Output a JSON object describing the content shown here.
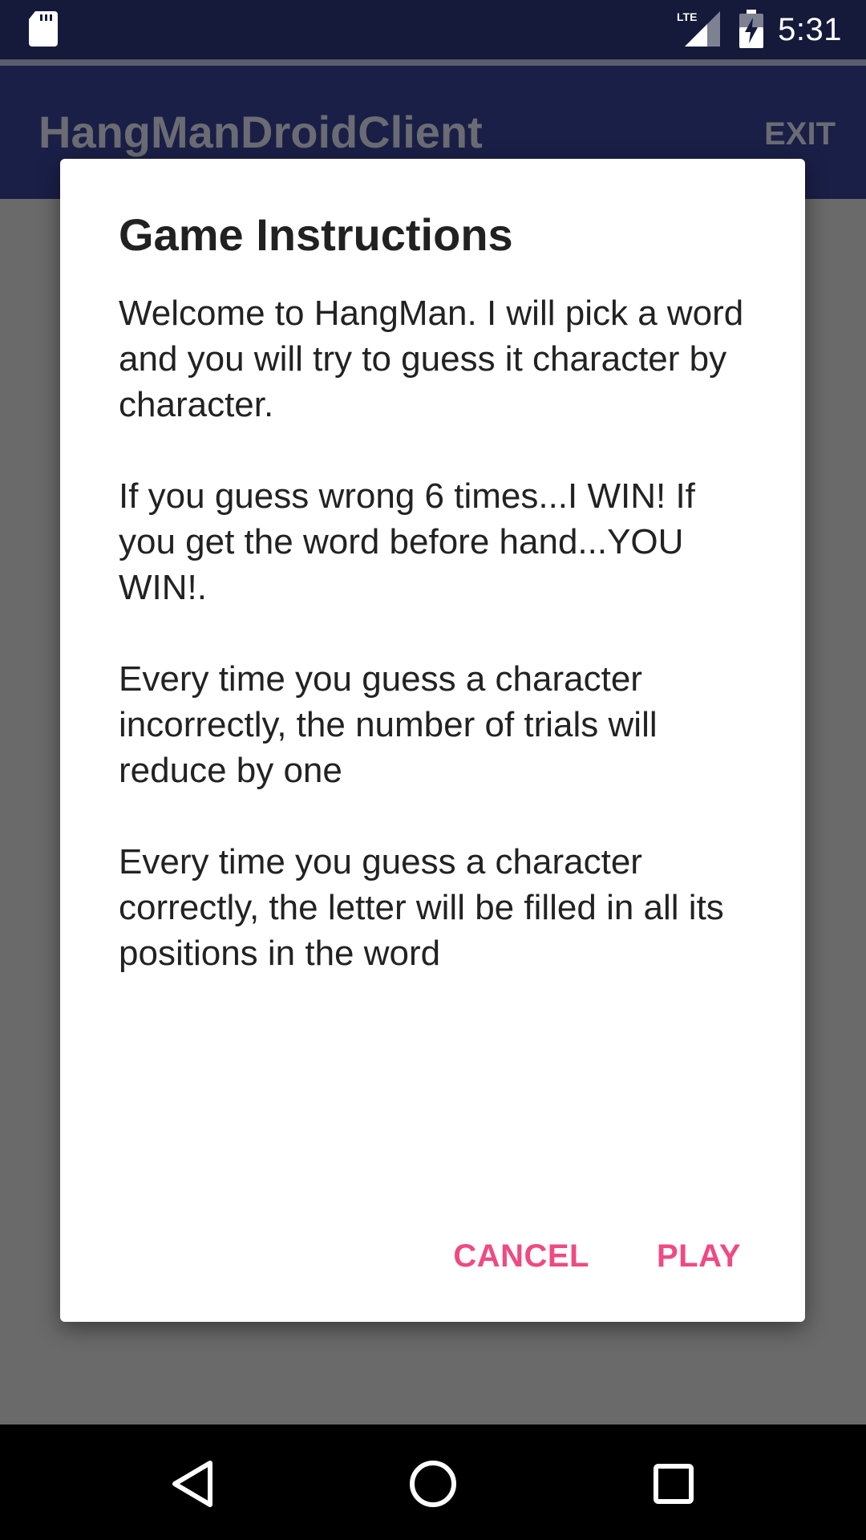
{
  "status_bar": {
    "time": "5:31",
    "network_label": "LTE",
    "icons": [
      "sd-card-icon",
      "signal-icon",
      "battery-icon"
    ]
  },
  "app_bar": {
    "title": "HangManDroidClient",
    "action_exit": "EXIT"
  },
  "dialog": {
    "title": "Game Instructions",
    "paragraphs": [
      "Welcome to HangMan. I will pick a word and you will try to guess it character by character.",
      "If you guess wrong 6 times...I WIN! If you get the word before hand...YOU WIN!.",
      "Every time you guess a character incorrectly, the number of trials will reduce by one",
      "Every time you guess a character correctly, the letter will be filled in all its positions in the word"
    ],
    "buttons": {
      "cancel": "CANCEL",
      "play": "PLAY"
    }
  },
  "nav_bar": {
    "icons": [
      "back-icon",
      "home-icon",
      "recents-icon"
    ]
  },
  "colors": {
    "status_bar": "#151a3a",
    "app_bar": "#1a1f47",
    "accent": "#ef4a82",
    "scrim": "#6a6a6a"
  }
}
